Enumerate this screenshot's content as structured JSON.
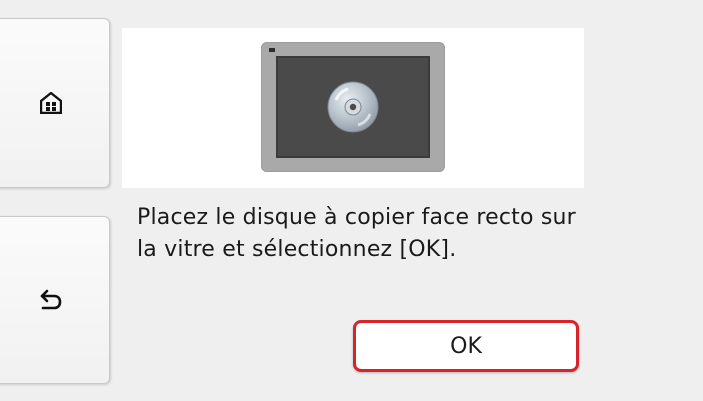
{
  "side_nav": {
    "home_icon": "home-icon",
    "back_icon": "back-arrow-icon"
  },
  "preview": {
    "illustration": "disc-on-scanner-glass"
  },
  "message": {
    "text": "Placez le disque à copier face recto sur la vitre et sélectionnez [OK]."
  },
  "actions": {
    "ok_label": "OK"
  },
  "colors": {
    "accent_border": "#d8232a",
    "panel_bg": "#ffffff",
    "screen_bg": "#efefef"
  }
}
